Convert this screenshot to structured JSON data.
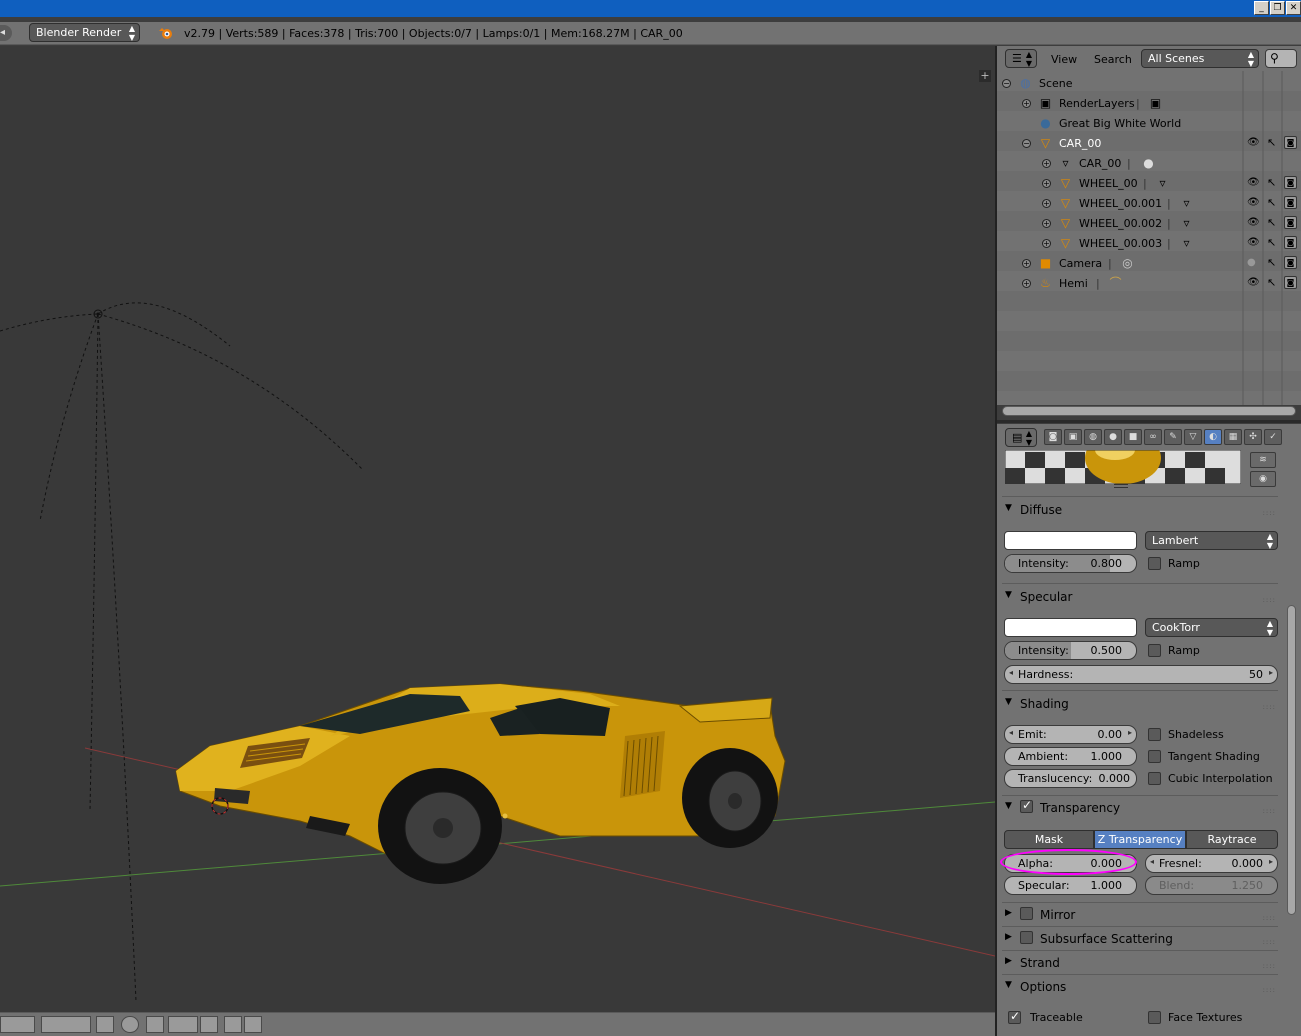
{
  "window": {
    "buttons": [
      "_",
      "❐",
      "✕"
    ]
  },
  "infobar": {
    "editor_icon": "◂",
    "render_engine": "Blender Render",
    "stats": "v2.79 | Verts:589 | Faces:378 | Tris:700 | Objects:0/7 | Lamps:0/1 | Mem:168.27M | CAR_00"
  },
  "viewport": {
    "plus": "+"
  },
  "outliner": {
    "header": {
      "view": "View",
      "search": "Search",
      "display_mode": "All Scenes"
    },
    "rows": [
      {
        "label": "Scene"
      },
      {
        "label": "RenderLayers"
      },
      {
        "label": "Great Big White World"
      },
      {
        "label": "CAR_00"
      },
      {
        "label": "CAR_00"
      },
      {
        "label": "WHEEL_00"
      },
      {
        "label": "WHEEL_00.001"
      },
      {
        "label": "WHEEL_00.002"
      },
      {
        "label": "WHEEL_00.003"
      },
      {
        "label": "Camera"
      },
      {
        "label": "Hemi"
      }
    ]
  },
  "properties": {
    "diffuse": {
      "title": "Diffuse",
      "color": "#ffffff",
      "shader": "Lambert",
      "intensity_label": "Intensity:",
      "intensity": "0.800",
      "intensity_fraction": 0.8,
      "ramp_label": "Ramp"
    },
    "specular": {
      "title": "Specular",
      "color": "#ffffff",
      "shader": "CookTorr",
      "intensity_label": "Intensity:",
      "intensity": "0.500",
      "intensity_fraction": 0.5,
      "ramp_label": "Ramp",
      "hardness_label": "Hardness:",
      "hardness": "50"
    },
    "shading": {
      "title": "Shading",
      "emit_label": "Emit:",
      "emit": "0.00",
      "ambient_label": "Ambient:",
      "ambient": "1.000",
      "translucency_label": "Translucency:",
      "translucency": "0.000",
      "shadeless": "Shadeless",
      "tangent": "Tangent Shading",
      "cubic": "Cubic Interpolation"
    },
    "transparency": {
      "title": "Transparency",
      "enabled": true,
      "modes": [
        "Mask",
        "Z Transparency",
        "Raytrace"
      ],
      "active_mode": "Z Transparency",
      "alpha_label": "Alpha:",
      "alpha": "0.000",
      "fresnel_label": "Fresnel:",
      "fresnel": "0.000",
      "specular_label": "Specular:",
      "specular": "1.000",
      "blend_label": "Blend:",
      "blend": "1.250"
    },
    "mirror": {
      "title": "Mirror"
    },
    "sss": {
      "title": "Subsurface Scattering"
    },
    "strand": {
      "title": "Strand"
    },
    "options": {
      "title": "Options",
      "traceable": "Traceable",
      "face_textures": "Face Textures"
    }
  },
  "colors": {
    "accent": "#5680c2",
    "highlight": "#ff00ff",
    "titlebar": "#0f5fbf",
    "car": "#d4a20c"
  }
}
